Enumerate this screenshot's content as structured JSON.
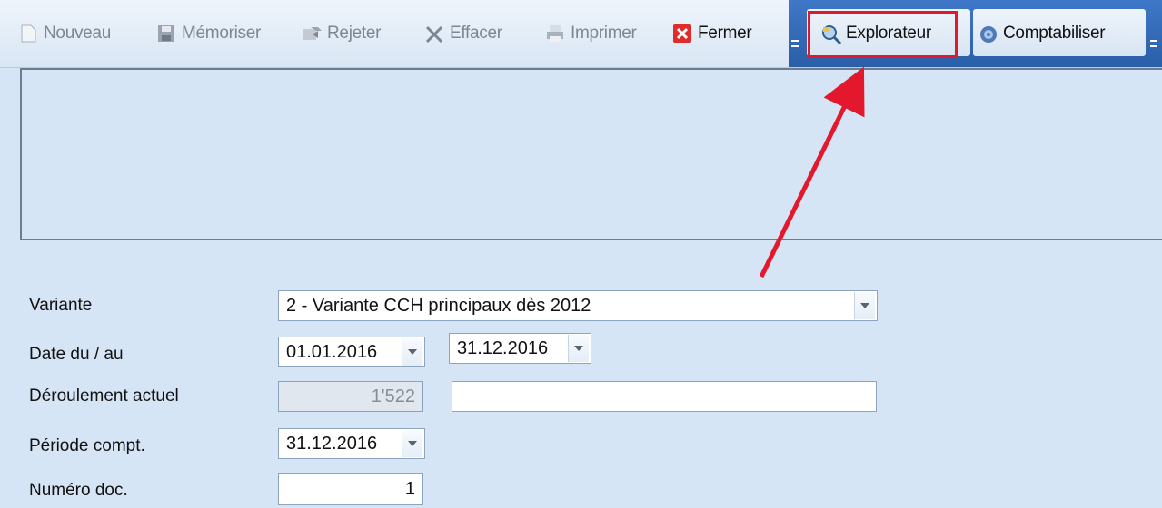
{
  "toolbar": {
    "new_label": "Nouveau",
    "save_label": "Mémoriser",
    "reject_label": "Rejeter",
    "clear_label": "Effacer",
    "print_label": "Imprimer",
    "close_label": "Fermer",
    "explorer_label": "Explorateur",
    "post_label": "Comptabiliser"
  },
  "form": {
    "variant_label": "Variante",
    "variant_value": "2 - Variante CCH principaux dès 2012",
    "date_label": "Date du / au",
    "date_from": "01.01.2016",
    "date_to": "31.12.2016",
    "run_label": "Déroulement actuel",
    "run_value": "1'522",
    "run_text": "",
    "period_label": "Période compt.",
    "period_value": "31.12.2016",
    "doc_label": "Numéro doc.",
    "doc_value": "1"
  },
  "colors": {
    "background": "#d6e5f5",
    "toolbar_accent": "#2a5ea8",
    "highlight_box": "#e3182c",
    "arrow": "#e3182c"
  }
}
